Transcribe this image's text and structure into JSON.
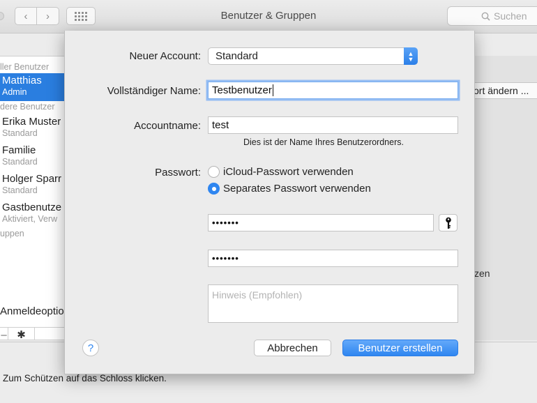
{
  "window": {
    "title": "Benutzer & Gruppen",
    "search_placeholder": "Suchen"
  },
  "sidebar": {
    "section_current": "ller Benutzer",
    "current_user": {
      "name": "Matthias",
      "role": "Admin"
    },
    "section_other": "dere Benutzer",
    "users": [
      {
        "name": "Erika Muster",
        "role": "Standard"
      },
      {
        "name": "Familie",
        "role": "Standard"
      },
      {
        "name": "Holger Sparr",
        "role": "Standard"
      },
      {
        "name": "Gastbenutze",
        "role": "Aktiviert, Verw"
      }
    ],
    "section_groups": "uppen",
    "login_options": "Anmeldeoptio"
  },
  "background": {
    "change_password_button": "ort ändern ...",
    "partial_text": "zen",
    "lock_text": "Zum Schützen auf das Schloss klicken."
  },
  "dialog": {
    "account_label": "Neuer Account:",
    "account_type": "Standard",
    "fullname_label": "Vollständiger Name:",
    "fullname_value": "Testbenutzer",
    "accountname_label": "Accountname:",
    "accountname_value": "test",
    "accountname_hint": "Dies ist der Name Ihres Benutzerordners.",
    "password_label": "Passwort:",
    "radio_icloud": "iCloud-Passwort verwenden",
    "radio_separate": "Separates Passwort verwenden",
    "selected_radio": "separate",
    "password_masked": "•••••••",
    "verify_masked": "•••••••",
    "hint_placeholder": "Hinweis (Empfohlen)",
    "help_label": "?",
    "cancel_button": "Abbrechen",
    "create_button": "Benutzer erstellen"
  },
  "colors": {
    "accent": "#2f86f0",
    "selection": "#2a7ee0",
    "focus_ring": "#95bdf3"
  }
}
